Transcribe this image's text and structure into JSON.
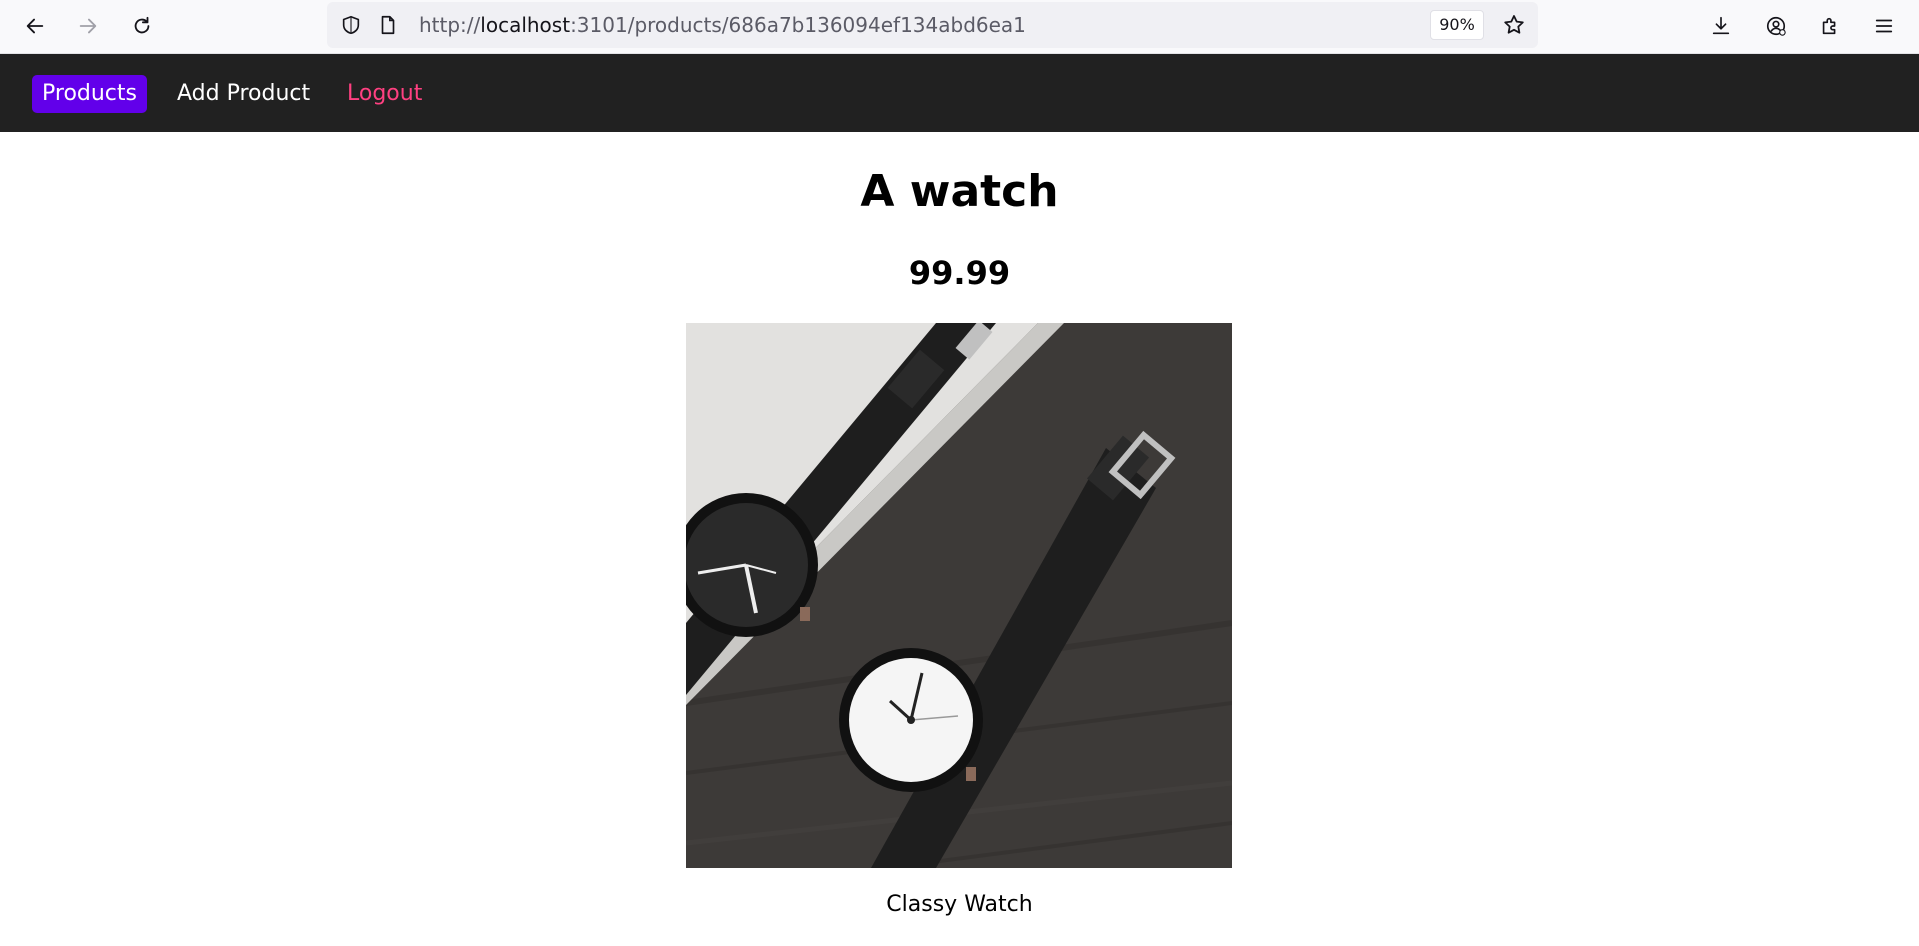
{
  "browser": {
    "url_prefix": "http://",
    "url_host": "localhost",
    "url_path": ":3101/products/686a7b136094ef134abd6ea1",
    "zoom": "90%"
  },
  "nav": {
    "products": "Products",
    "add_product": "Add Product",
    "logout": "Logout"
  },
  "product": {
    "title": "A watch",
    "price": "99.99",
    "description": "Classy Watch"
  },
  "colors": {
    "navbar_bg": "#212121",
    "active_link_bg": "#6200ea",
    "logout": "#ff4081"
  }
}
